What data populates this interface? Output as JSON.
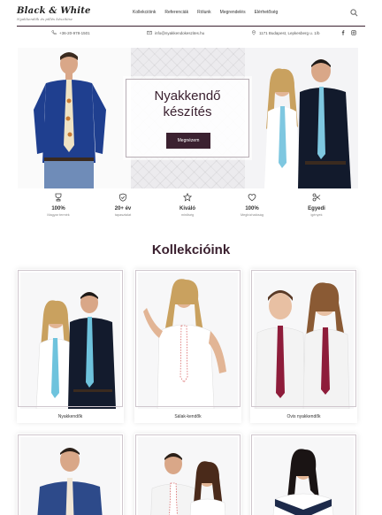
{
  "brand": {
    "name": "Black & White",
    "tagline": "Nyakkendők és pillés készítése"
  },
  "nav": {
    "items": [
      "Kollekcióink",
      "Referenciák",
      "Rólunk",
      "Megrendelés",
      "Elérhetőség"
    ]
  },
  "contact": {
    "phone": "+36-20-978-1501",
    "email": "info@nyakkendokeszites.hu",
    "address": "1171 Budapest, Lepkesberg u. 1/b"
  },
  "hero": {
    "title_line1": "Nyakkendő",
    "title_line2": "készítés",
    "button": "Megnézem"
  },
  "features": [
    {
      "icon": "award-icon",
      "title": "100%",
      "subtitle": "Magyar termék"
    },
    {
      "icon": "shield-icon",
      "title": "20+ év",
      "subtitle": "tapasztalat"
    },
    {
      "icon": "star-icon",
      "title": "Kiváló",
      "subtitle": "minőség"
    },
    {
      "icon": "heart-icon",
      "title": "100%",
      "subtitle": "Megbízhatóság"
    },
    {
      "icon": "scissors-icon",
      "title": "Egyedi",
      "subtitle": "igények"
    }
  ],
  "section": {
    "title": "Kollekcióink"
  },
  "collections": [
    {
      "label": "Nyakkendők"
    },
    {
      "label": "Sálak-kendők"
    },
    {
      "label": "Ovis nyakkendők"
    },
    {
      "label": ""
    },
    {
      "label": ""
    },
    {
      "label": ""
    }
  ],
  "colors": {
    "brand": "#3b2130",
    "text": "#333333",
    "muted": "#888888"
  }
}
